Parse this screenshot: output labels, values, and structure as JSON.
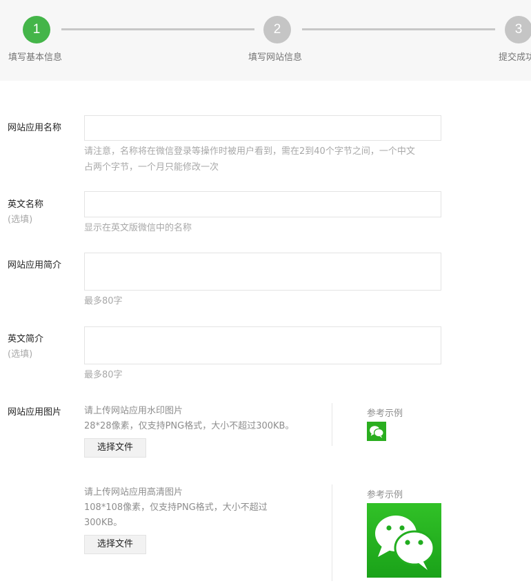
{
  "steps": [
    {
      "number": "1",
      "label": "填写基本信息"
    },
    {
      "number": "2",
      "label": "填写网站信息"
    },
    {
      "number": "3",
      "label": "提交成功"
    }
  ],
  "form": {
    "app_name": {
      "label": "网站应用名称",
      "hint_line1": "请注意，名称将在微信登录等操作时被用户看到，需在2到40个字节之间，一个中文",
      "hint_line2": "占两个字节，一个月只能修改一次"
    },
    "english_name": {
      "label": "英文名称",
      "optional": "(选填)",
      "hint": "显示在英文版微信中的名称"
    },
    "app_intro": {
      "label": "网站应用简介",
      "hint": "最多80字"
    },
    "english_intro": {
      "label": "英文简介",
      "optional": "(选填)",
      "hint": "最多80字"
    },
    "app_image": {
      "label": "网站应用图片",
      "watermark": {
        "title": "请上传网站应用水印图片",
        "spec": "28*28像素，仅支持PNG格式，大小不超过300KB。",
        "button": "选择文件",
        "example": "参考示例"
      },
      "hd": {
        "title": "请上传网站应用高清图片",
        "spec_line1": "108*108像素，仅支持PNG格式，大小不超过",
        "spec_line2": "300KB。",
        "button": "选择文件",
        "example": "参考示例"
      }
    }
  },
  "colors": {
    "accent": "#44b549",
    "wechat_green": "#2aae1f",
    "pending_step": "#c5c5c5"
  },
  "icons": {
    "example_icon": "wechat-logo-icon"
  }
}
